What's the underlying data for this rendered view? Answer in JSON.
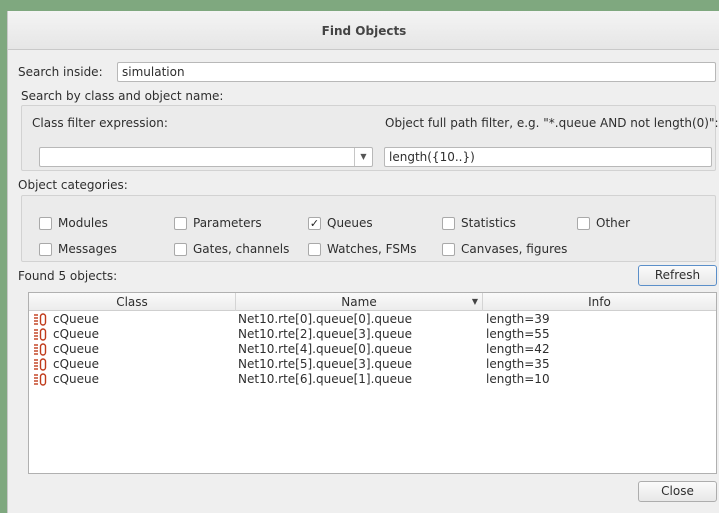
{
  "title": "Find Objects",
  "search_inside": {
    "label": "Search inside:",
    "value": "simulation"
  },
  "search_by": {
    "label": "Search by class and object name:"
  },
  "class_filter": {
    "label": "Class filter expression:",
    "value": ""
  },
  "path_filter": {
    "label": "Object full path filter, e.g. \"*.queue AND not length(0)\":",
    "value": "length({10..})"
  },
  "categories": {
    "label": "Object categories:",
    "row1": [
      {
        "label": "Modules",
        "checked": false
      },
      {
        "label": "Parameters",
        "checked": false
      },
      {
        "label": "Queues",
        "checked": true
      },
      {
        "label": "Statistics",
        "checked": false
      },
      {
        "label": "Other",
        "checked": false
      }
    ],
    "row2": [
      {
        "label": "Messages",
        "checked": false
      },
      {
        "label": "Gates, channels",
        "checked": false
      },
      {
        "label": "Watches, FSMs",
        "checked": false
      },
      {
        "label": "Canvases, figures",
        "checked": false
      }
    ],
    "check_mark": "✓"
  },
  "results": {
    "found_label": "Found 5 objects:",
    "refresh_label": "Refresh"
  },
  "table": {
    "headers": {
      "class": "Class",
      "name": "Name",
      "info": "Info"
    },
    "rows": [
      {
        "class": "cQueue",
        "name": "Net10.rte[0].queue[0].queue",
        "info": "length=39"
      },
      {
        "class": "cQueue",
        "name": "Net10.rte[2].queue[3].queue",
        "info": "length=55"
      },
      {
        "class": "cQueue",
        "name": "Net10.rte[4].queue[0].queue",
        "info": "length=42"
      },
      {
        "class": "cQueue",
        "name": "Net10.rte[5].queue[3].queue",
        "info": "length=35"
      },
      {
        "class": "cQueue",
        "name": "Net10.rte[6].queue[1].queue",
        "info": "length=10"
      }
    ]
  },
  "close_label": "Close",
  "colors": {
    "queue_icon": "#c03a1a"
  }
}
